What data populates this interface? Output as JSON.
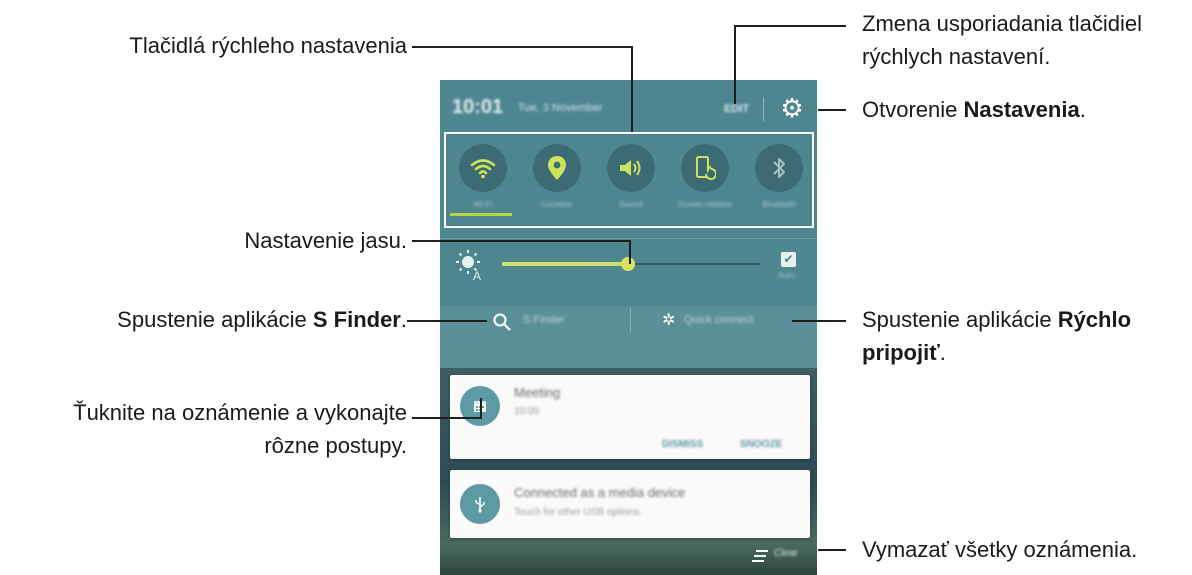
{
  "status": {
    "time": "10:01",
    "date": "Tue, 3 November",
    "edit_label": "EDIT"
  },
  "quick_settings": [
    {
      "label": "Wi-Fi",
      "icon": "wifi-icon",
      "active": true
    },
    {
      "label": "Location",
      "icon": "location-pin-icon",
      "active": true
    },
    {
      "label": "Sound",
      "icon": "speaker-icon",
      "active": true
    },
    {
      "label": "Screen rotation",
      "icon": "screen-rotation-icon",
      "active": true
    },
    {
      "label": "Bluetooth",
      "icon": "bluetooth-icon",
      "active": false
    }
  ],
  "brightness": {
    "level_percent": 49,
    "auto_label": "Auto",
    "auto_checked": true
  },
  "shortcuts": {
    "s_finder": "S Finder",
    "quick_connect": "Quick connect"
  },
  "notifications": [
    {
      "title": "Meeting",
      "subtitle": "10:00",
      "icon": "calendar-icon",
      "actions": [
        "DISMISS",
        "SNOOZE"
      ]
    },
    {
      "title": "Connected as a media device",
      "subtitle": "Touch for other USB options.",
      "icon": "usb-icon"
    }
  ],
  "clear_label": "Clear",
  "callouts": {
    "quick_buttons": "Tlačidlá rýchleho nastavenia",
    "rearrange_line1": "Zmena usporiadania tlačidiel",
    "rearrange_line2": "rýchlych nastavení.",
    "open_settings_prefix": "Otvorenie ",
    "open_settings_bold": "Nastavenia",
    "open_settings_suffix": ".",
    "brightness": "Nastavenie jasu.",
    "sfinder_prefix": "Spustenie aplikácie ",
    "sfinder_bold": "S Finder",
    "sfinder_suffix": ".",
    "quickconnect_prefix": "Spustenie aplikácie ",
    "quickconnect_bold1": "Rýchlo",
    "quickconnect_bold2": "pripojiť",
    "quickconnect_suffix": ".",
    "notification_line1": "Ťuknite na oznámenie a vykonajte",
    "notification_line2": "rôzne postupy.",
    "clear_all": "Vymazať všetky oznámenia."
  },
  "colors": {
    "panel": "#4e8690",
    "accent": "#cfdc6b",
    "card": "#fafafa"
  }
}
